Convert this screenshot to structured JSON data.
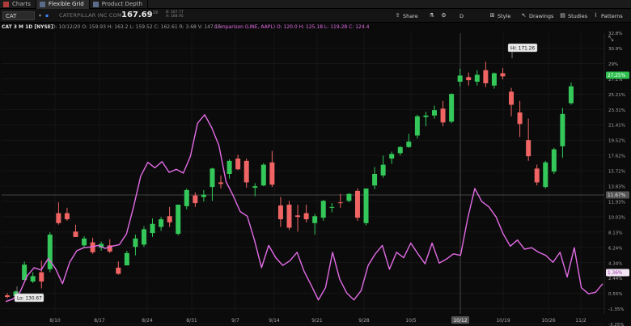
{
  "tabs": [
    {
      "label": "Charts"
    },
    {
      "label": "Flexible Grid"
    },
    {
      "label": "Product Depth"
    }
  ],
  "toolbar": {
    "symbol": "CAT",
    "company": "CATERPILLAR INC COM",
    "last": "167.69",
    "change": "-2.19",
    "bid": "B: 167.77",
    "ask": "A: 168.95",
    "share": "Share",
    "period": "D",
    "style": "Style",
    "drawings": "Drawings",
    "studies": "Studies",
    "patterns": "Patterns"
  },
  "chart_header": {
    "symbol": "CAT 3 M 1D [NYSE]",
    "ohlc": "D: 10/12/20  O: 159.93  H: 163.2  L: 159.52  C: 162.61  R: 3.68  V: 147.15",
    "comparison": "Comparison (LINE, AAPL)  O: 120.0  H: 125.18  L: 119.28  C: 124.4"
  },
  "annotations": {
    "hi": "Hi: 171.26",
    "lo": "Lo: 130.67",
    "cursor_date": "10/12",
    "current_pct": "27.25%",
    "cursor_pct": "11.67%",
    "compare_pct": "1.36%"
  },
  "colors": {
    "up": "#34c759",
    "down": "#f06464",
    "compare": "#e36be6",
    "grid": "#1c1c1c"
  },
  "chart_data": {
    "type": "candlestick",
    "y_axis_pct_ticks": [
      "32.8%",
      "30.9%",
      "29%",
      "27.1%",
      "25.21%",
      "23.31%",
      "21.41%",
      "19.52%",
      "17.62%",
      "15.72%",
      "13.83%",
      "11.93%",
      "10.03%",
      "8.13%",
      "6.24%",
      "4.34%",
      "2.44%",
      "0.55%",
      "-1.35%",
      "-3.25%"
    ],
    "x_ticks": [
      "8/10",
      "8/17",
      "8/24",
      "8/31",
      "9/7",
      "9/14",
      "9/21",
      "9/28",
      "10/5",
      "10/12",
      "10/19",
      "10/26",
      "11/2"
    ],
    "series": [
      {
        "name": "CAT",
        "type": "candlestick",
        "ohlc": [
          [
            0.0,
            0.3,
            -0.4,
            -0.2
          ],
          [
            -0.1,
            0.6,
            -0.5,
            0.5
          ],
          [
            2.0,
            4.4,
            2.0,
            4.0
          ],
          [
            1.8,
            3.0,
            1.6,
            2.5
          ],
          [
            3.0,
            4.5,
            0.9,
            1.8
          ],
          [
            3.4,
            8.2,
            3.0,
            7.9
          ],
          [
            10.7,
            12.1,
            9.2,
            9.4
          ],
          [
            10.7,
            11.4,
            9.7,
            9.9
          ],
          [
            8.3,
            9.2,
            7.6,
            7.6
          ],
          [
            6.5,
            7.7,
            6.2,
            7.4
          ],
          [
            6.9,
            7.5,
            5.4,
            5.6
          ],
          [
            6.2,
            7.0,
            5.8,
            6.7
          ],
          [
            6.5,
            7.3,
            5.5,
            5.7
          ],
          [
            3.6,
            4.4,
            2.7,
            2.8
          ],
          [
            3.9,
            5.8,
            3.9,
            5.5
          ],
          [
            6.3,
            7.9,
            5.2,
            7.4
          ],
          [
            6.6,
            9.0,
            6.3,
            8.6
          ],
          [
            8.1,
            10.0,
            7.6,
            9.3
          ],
          [
            8.9,
            10.2,
            8.4,
            9.9
          ],
          [
            10.3,
            11.5,
            8.9,
            9.5
          ],
          [
            8.0,
            11.8,
            7.8,
            11.8
          ],
          [
            11.6,
            13.9,
            11.2,
            13.7
          ],
          [
            13.0,
            13.4,
            11.5,
            12.0
          ],
          [
            12.8,
            13.7,
            12.2,
            13.1
          ],
          [
            14.1,
            16.6,
            12.3,
            16.5
          ],
          [
            14.7,
            15.6,
            13.9,
            14.5
          ],
          [
            15.8,
            17.7,
            15.2,
            17.5
          ],
          [
            17.8,
            18.3,
            16.3,
            16.4
          ],
          [
            17.5,
            17.8,
            14.0,
            14.7
          ],
          [
            14.0,
            14.6,
            12.9,
            14.2
          ],
          [
            14.3,
            17.2,
            14.2,
            17.0
          ],
          [
            17.3,
            18.8,
            14.1,
            14.4
          ],
          [
            11.7,
            12.8,
            8.9,
            9.9
          ],
          [
            11.8,
            12.3,
            8.5,
            8.8
          ],
          [
            10.4,
            11.8,
            8.3,
            10.2
          ],
          [
            10.7,
            11.8,
            9.5,
            9.9
          ],
          [
            9.4,
            10.6,
            7.9,
            10.3
          ],
          [
            10.1,
            12.4,
            9.7,
            12.3
          ],
          [
            11.5,
            12.0,
            10.8,
            11.5
          ],
          [
            12.1,
            13.2,
            11.4,
            12.0
          ],
          [
            12.3,
            13.3,
            12.1,
            13.2
          ],
          [
            13.6,
            13.9,
            9.7,
            10.1
          ],
          [
            9.4,
            13.9,
            9.1,
            13.9
          ],
          [
            14.3,
            16.7,
            13.8,
            15.8
          ],
          [
            15.6,
            18.2,
            15.3,
            17.0
          ],
          [
            17.8,
            18.7,
            17.1,
            18.4
          ],
          [
            18.5,
            19.4,
            18.2,
            19.3
          ],
          [
            19.3,
            21.0,
            19.2,
            20.0
          ],
          [
            20.8,
            23.5,
            20.4,
            23.3
          ],
          [
            23.2,
            23.9,
            22.0,
            23.4
          ],
          [
            23.4,
            24.7,
            23.0,
            24.1
          ],
          [
            24.3,
            25.3,
            22.0,
            22.5
          ],
          [
            22.6,
            26.3,
            22.4,
            26.2
          ],
          [
            27.8,
            29.5,
            27.2,
            28.6
          ],
          [
            28.4,
            29.0,
            27.3,
            28.0
          ],
          [
            27.8,
            29.3,
            27.3,
            28.7
          ],
          [
            29.3,
            30.4,
            27.1,
            27.6
          ],
          [
            27.3,
            29.0,
            26.9,
            28.9
          ],
          [
            28.9,
            29.6,
            28.1,
            28.5
          ],
          [
            26.5,
            27.0,
            23.3,
            24.8
          ],
          [
            23.8,
            25.3,
            20.6,
            22.3
          ],
          [
            20.2,
            23.0,
            17.5,
            18.1
          ],
          [
            16.5,
            17.0,
            14.3,
            14.7
          ],
          [
            14.1,
            17.5,
            13.9,
            17.3
          ],
          [
            16.1,
            19.2,
            15.8,
            19.0
          ],
          [
            19.4,
            24.4,
            17.9,
            23.6
          ],
          [
            25.0,
            27.7,
            24.8,
            27.2
          ]
        ]
      },
      {
        "name": "AAPL",
        "type": "line",
        "values": [
          -0.8,
          -0.5,
          0.4,
          2.5,
          3.6,
          3.3,
          4.8,
          3.5,
          1.5,
          4.3,
          5.8,
          6.2,
          6.3,
          6.5,
          6.1,
          6.4,
          6.6,
          8.0,
          11.5,
          15.5,
          17.3,
          16.6,
          17.4,
          16.0,
          16.4,
          15.9,
          18.1,
          22.4,
          23.5,
          21.8,
          19.5,
          14.8,
          13.0,
          10.9,
          10.3,
          7.2,
          3.6,
          6.5,
          4.9,
          3.9,
          4.5,
          5.6,
          3.1,
          1.3,
          -0.6,
          1.0,
          5.6,
          2.1,
          0.3,
          -0.6,
          0.6,
          3.9,
          5.4,
          6.5,
          3.4,
          5.6,
          4.9,
          6.8,
          5.4,
          4.1,
          6.8,
          4.2,
          4.7,
          5.4,
          5.2,
          10.0,
          13.9,
          12.2,
          11.5,
          10.2,
          8.0,
          6.4,
          7.2,
          6.0,
          6.2,
          5.6,
          5.2,
          4.3,
          5.6,
          2.4,
          6.2,
          1.0,
          0.2,
          0.4,
          1.5
        ]
      }
    ]
  }
}
